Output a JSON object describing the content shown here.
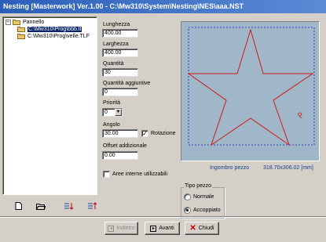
{
  "window": {
    "title": "Nesting [Masterwork] Ver.1.00 - C:\\Mw310\\System\\Nesting\\NES\\aaa.NST"
  },
  "tree": {
    "root_label": "Pannello",
    "items": [
      {
        "label": "C:\\Mw310\\Prog\\bbb.tl",
        "selected": true
      },
      {
        "label": "C:\\Mw310\\Prog\\velle.TLF",
        "selected": false
      }
    ],
    "toolbar_icons": [
      "new-file-icon",
      "open-folder-icon",
      "sort-down-icon",
      "sort-up-icon"
    ]
  },
  "form": {
    "lunghezza_label": "Lunghezza",
    "lunghezza_value": "400.00",
    "larghezza_label": "Larghezza",
    "larghezza_value": "400.00",
    "quantita_label": "Quantità",
    "quantita_value": "30",
    "quantita_agg_label": "Quantità aggiuntive",
    "quantita_agg_value": "0",
    "priorita_label": "Priorità",
    "priorita_value": "0",
    "angolo_label": "Angolo",
    "angolo_value": "30.00",
    "rotazione_label": "Rotazione",
    "rotazione_checked": true,
    "offset_label": "Offset addizionale",
    "offset_value": "0.00",
    "aree_label": "Aree interne utilizzabili",
    "aree_checked": false
  },
  "tipo_pezzo": {
    "title": "Tipo pezzo",
    "options": [
      {
        "label": "Normale",
        "checked": false
      },
      {
        "label": "Accoppiato",
        "checked": true
      }
    ]
  },
  "preview": {
    "ingombro_label": "Ingombro pezzo",
    "ingombro_value": "318.70x306.02 [mm]"
  },
  "buttons": {
    "indietro": "Indietro",
    "avanti": "Avanti",
    "chiudi": "Chiudi"
  },
  "colors": {
    "titlebar": "#2b5fb8",
    "preview_bg": "#9fb7c8",
    "star_stroke": "#d01818",
    "frame_stroke": "#2020c0"
  }
}
